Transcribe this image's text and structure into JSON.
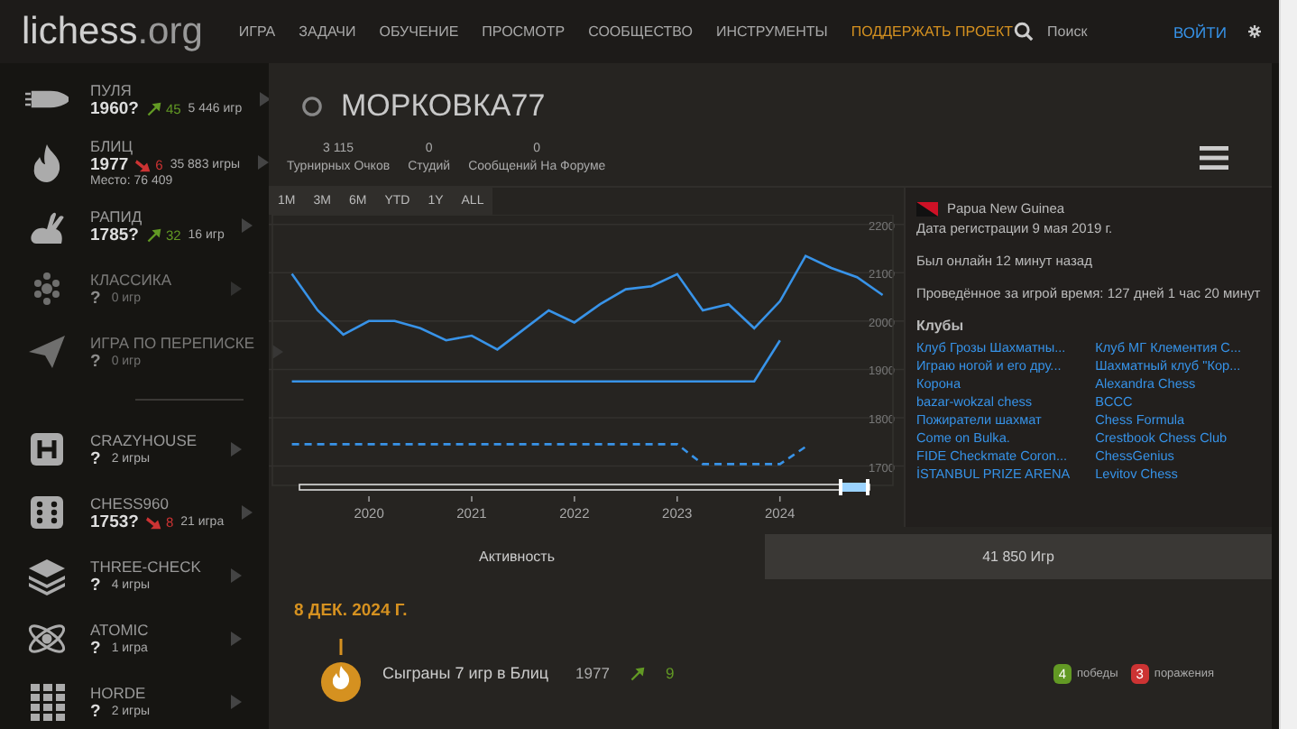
{
  "header": {
    "logo": {
      "name": "lichess",
      "suffix": ".org"
    },
    "nav": [
      {
        "label": "ИГРА",
        "kind": "plain"
      },
      {
        "label": "ЗАДАЧИ",
        "kind": "plain"
      },
      {
        "label": "ОБУЧЕНИЕ",
        "kind": "plain"
      },
      {
        "label": "ПРОСМОТР",
        "kind": "plain"
      },
      {
        "label": "СООБЩЕСТВО",
        "kind": "plain"
      },
      {
        "label": "ИНСТРУМЕНТЫ",
        "kind": "plain"
      },
      {
        "label": "ПОДДЕРЖАТЬ ПРОЕКТ",
        "kind": "highlight"
      }
    ],
    "search": {
      "placeholder": "Поиск"
    },
    "login": "ВОЙТИ"
  },
  "sidebar": {
    "groups": [
      {
        "items": [
          {
            "name": "ПУЛЯ",
            "rating": "1960?",
            "gain": true,
            "progress": "45",
            "games": "5 446 игр",
            "disabled": false
          },
          {
            "name": "БЛИЦ",
            "rating": "1977",
            "gain": false,
            "progress": "6",
            "games": "35 883 игры",
            "rank": "Место: 76 409",
            "disabled": false
          },
          {
            "name": "РАПИД",
            "rating": "1785?",
            "gain": true,
            "progress": "32",
            "games": "16 игр",
            "disabled": false
          },
          {
            "name": "КЛАССИКА",
            "rating": "?",
            "games": "0 игр",
            "disabled": true
          },
          {
            "name": "ИГРА ПО ПЕРЕПИСКЕ",
            "rating": "?",
            "games": "0 игр",
            "disabled": true
          }
        ]
      },
      {
        "items": [
          {
            "name": "CRAZYHOUSE",
            "rating": "?",
            "games": "2 игры",
            "disabled": false
          },
          {
            "name": "CHESS960",
            "rating": "1753?",
            "gain": false,
            "progress": "8",
            "games": "21 игра",
            "disabled": false
          },
          {
            "name": "THREE-CHECK",
            "rating": "?",
            "games": "4 игры",
            "disabled": false
          },
          {
            "name": "ATOMIC",
            "rating": "?",
            "games": "1 игра",
            "disabled": false
          },
          {
            "name": "HORDE",
            "rating": "?",
            "games": "2 игры",
            "disabled": false
          }
        ]
      }
    ]
  },
  "profile": {
    "title": "МОРКОВКА77",
    "online": false,
    "stats": [
      {
        "value": "3 115",
        "label": "Турнирных Очков"
      },
      {
        "value": "0",
        "label": "Студий"
      },
      {
        "value": "0",
        "label": "Сообщений На Форуме"
      }
    ]
  },
  "rating_chart": {
    "periods": [
      "1M",
      "3M",
      "6M",
      "YTD",
      "1Y",
      "ALL"
    ],
    "chart_data": {
      "type": "line",
      "x": [
        2019.25,
        2019.5,
        2019.75,
        2020,
        2020.25,
        2020.5,
        2020.75,
        2021,
        2021.25,
        2021.5,
        2021.75,
        2022,
        2022.25,
        2022.5,
        2022.75,
        2023,
        2023.25,
        2023.5,
        2023.75,
        2024,
        2024.25,
        2024.5,
        2024.75,
        2025
      ],
      "series": [
        {
          "color": "#3893e8",
          "line_style": "solid",
          "values": [
            2098,
            2022,
            1972,
            2000,
            2000,
            1985,
            1960,
            1970,
            1941,
            1982,
            2022,
            1997,
            2035,
            2066,
            2072,
            2097,
            2022,
            2035,
            1985,
            2041,
            2135,
            2110,
            2091,
            2054
          ]
        },
        {
          "color": "#3893e8",
          "line_style": "solid",
          "values": [
            1875,
            1875,
            1875,
            1875,
            1875,
            1875,
            1875,
            1875,
            1875,
            1875,
            1875,
            1875,
            1875,
            1875,
            1875,
            1875,
            1875,
            1875,
            1875,
            1960,
            null,
            null,
            null,
            null
          ]
        },
        {
          "color": "#3893e8",
          "line_style": "dashed",
          "values": [
            1745,
            1745,
            1745,
            1745,
            1745,
            1745,
            1745,
            1745,
            1745,
            1745,
            1745,
            1745,
            1745,
            1745,
            1745,
            1745,
            1704,
            1704,
            1704,
            1704,
            1740,
            null,
            null,
            null
          ]
        }
      ],
      "grid": true,
      "xlim": [
        2019.06,
        2025.1
      ],
      "ylim": [
        1660,
        2220
      ],
      "xticks": [
        2020,
        2021,
        2022,
        2023,
        2024
      ],
      "yticks": [
        1700,
        1800,
        1900,
        2000,
        2100,
        2200
      ]
    }
  },
  "info": {
    "country": "Papua New Guinea",
    "registered": "Дата регистрации 9 мая 2019 г.",
    "last_seen": "Был онлайн 12 минут назад",
    "play_time": "Проведённое за игрой время: 127 дней 1 час 20 минут",
    "clubs_title": "Клубы",
    "clubs": [
      "Клуб Грозы Шахматны...",
      "Клуб МГ Клементия С...",
      "Играю ногой и его дру...",
      "Шахматный клуб \"Кор...",
      "Корона",
      "Alexandra Chess",
      "bazar-wokzal chess",
      "BCCC",
      "Пожиратели шахмат",
      "Chess Formula",
      "Come on Bulka.",
      "Crestbook Chess Club",
      "FIDE Checkmate Coron...",
      "ChessGenius",
      "İSTANBUL PRIZE ARENA",
      "Levitov Chess"
    ]
  },
  "tabs": [
    {
      "label": "Активность",
      "selected": true
    },
    {
      "label": "41 850 Игр",
      "selected": false
    }
  ],
  "activity": [
    {
      "date": "8 ДЕК. 2024 Г.",
      "entries": [
        {
          "text": "Сыграны 7 игр в Блиц",
          "rating": "1977",
          "gain": true,
          "progress": "9",
          "wins": "4",
          "wins_label": "победы",
          "losses": "3",
          "losses_label": "поражения"
        }
      ]
    }
  ]
}
